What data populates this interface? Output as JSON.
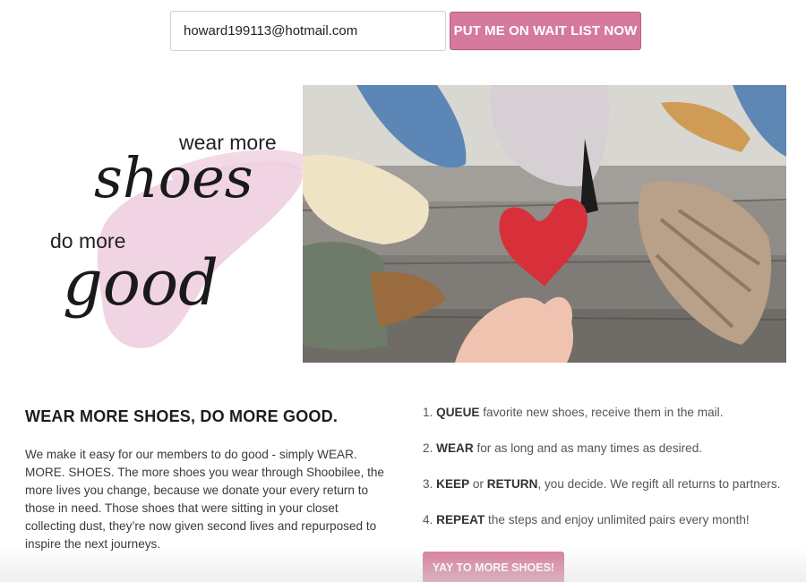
{
  "signup": {
    "email_value": "howard199113@hotmail.com",
    "button_label": "PUT ME ON WAIT LIST NOW"
  },
  "hero": {
    "logo_line1": "wear more",
    "logo_script1": "shoes",
    "logo_line2": "do more",
    "logo_script2": "good"
  },
  "intro": {
    "title": "WEAR MORE SHOES, DO MORE GOOD.",
    "body": "We make it easy for our members to do good - simply WEAR. MORE. SHOES. The more shoes you wear through Shoobilee, the more lives you change, because we donate your every return to those in need. Those shoes that were sitting in your closet collecting dust, they’re now given second lives and repurposed to inspire the next journeys."
  },
  "steps": [
    {
      "num": "1.",
      "key": "QUEUE",
      "text": " favorite new shoes, receive them in the mail."
    },
    {
      "num": "2.",
      "key": "WEAR",
      "text": " for as long and as many times as desired."
    },
    {
      "num": "3.",
      "key": "KEEP",
      "mid": " or ",
      "key2": "RETURN",
      "text": ", you decide. We regift all returns to partners."
    },
    {
      "num": "4.",
      "key": "REPEAT",
      "text": " the steps and enjoy unlimited pairs every month!"
    }
  ],
  "cta": {
    "label": "YAY TO MORE SHOES!"
  },
  "colors": {
    "accent": "#d57a9c",
    "brush": "#f0cfe0",
    "heart": "#d8303a"
  }
}
